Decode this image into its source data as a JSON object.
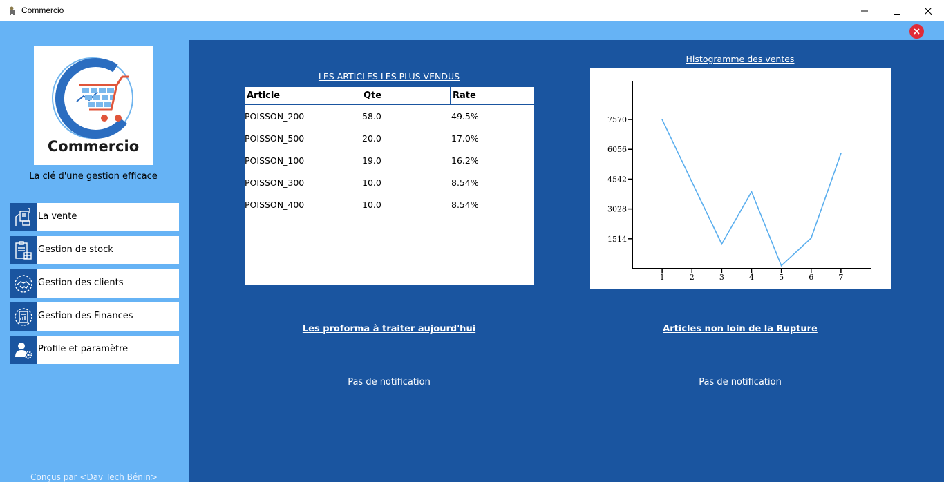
{
  "window": {
    "title": "Commercio"
  },
  "logo": {
    "text": "Commercio"
  },
  "tagline": "La clé d'une gestion efficace",
  "nav": [
    {
      "label": "La vente",
      "icon": "cash-register-icon"
    },
    {
      "label": "Gestion de stock",
      "icon": "clipboard-boxes-icon"
    },
    {
      "label": "Gestion des clients",
      "icon": "handshake-icon"
    },
    {
      "label": "Gestion des Finances",
      "icon": "finance-report-icon"
    },
    {
      "label": "Profile et paramètre",
      "icon": "user-settings-icon"
    }
  ],
  "credits": "Conçus par <Dav Tech Bénin>",
  "top_sellers": {
    "title": "LES ARTICLES LES PLUS VENDUS",
    "columns": [
      "Article",
      "Qte",
      "Rate"
    ],
    "rows": [
      [
        "POISSON_200",
        "58.0",
        "49.5%"
      ],
      [
        "POISSON_500",
        "20.0",
        "17.0%"
      ],
      [
        "POISSON_100",
        "19.0",
        "16.2%"
      ],
      [
        "POISSON_300",
        "10.0",
        "8.54%"
      ],
      [
        "POISSON_400",
        "10.0",
        "8.54%"
      ]
    ]
  },
  "chart_data": {
    "type": "line",
    "title": "Histogramme des ventes",
    "x": [
      1,
      2,
      3,
      4,
      5,
      6,
      7
    ],
    "y": [
      7570,
      4400,
      1250,
      3900,
      150,
      1550,
      5850
    ],
    "y_ticks": [
      1514,
      3028,
      4542,
      6056,
      7570
    ],
    "x_ticks": [
      1,
      2,
      3,
      4,
      5,
      6,
      7
    ],
    "ylim": [
      0,
      9500
    ],
    "xlim": [
      0,
      8
    ],
    "grid": false,
    "color": "#5aaeee"
  },
  "proforma": {
    "title": "Les proforma à traiter aujourd'hui",
    "empty": "Pas de notification"
  },
  "rupture": {
    "title": "Articles non loin de la Rupture",
    "empty": "Pas de notification"
  },
  "colors": {
    "sidebar": "#66b3f5",
    "main": "#1a55a0",
    "close": "#e02b38"
  }
}
